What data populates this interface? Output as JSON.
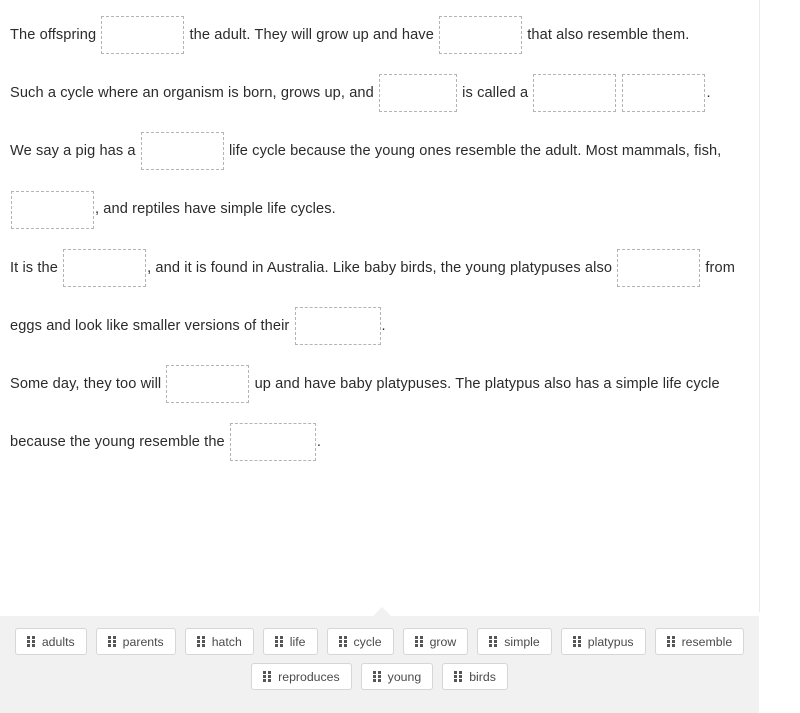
{
  "passage": {
    "paragraphs": [
      {
        "id": "p1",
        "parts": [
          {
            "type": "text",
            "value": "The offspring"
          },
          {
            "type": "blank",
            "name": "blank-1"
          },
          {
            "type": "text",
            "value": "the adult. They will grow up and have"
          },
          {
            "type": "blank",
            "name": "blank-2"
          },
          {
            "type": "text",
            "value": "that also resemble them."
          }
        ]
      },
      {
        "id": "p2",
        "parts": [
          {
            "type": "text",
            "value": "Such a cycle where an organism is born, grows up, and"
          },
          {
            "type": "blank",
            "name": "blank-3"
          },
          {
            "type": "text",
            "value": "is called a"
          },
          {
            "type": "blank",
            "name": "blank-4"
          },
          {
            "type": "blank",
            "name": "blank-5"
          },
          {
            "type": "text",
            "value": "."
          }
        ]
      },
      {
        "id": "p3",
        "parts": [
          {
            "type": "text",
            "value": "We say a pig has a"
          },
          {
            "type": "blank",
            "name": "blank-6"
          },
          {
            "type": "text",
            "value": "life cycle because the young ones resemble the adult. Most mammals, fish,"
          },
          {
            "type": "blank",
            "name": "blank-7"
          },
          {
            "type": "text",
            "value": ", and reptiles have simple life cycles."
          }
        ]
      },
      {
        "id": "p4",
        "parts": [
          {
            "type": "text",
            "value": "It is the"
          },
          {
            "type": "blank",
            "name": "blank-8"
          },
          {
            "type": "text",
            "value": ", and it is found in Australia. Like baby birds, the young platypuses also"
          },
          {
            "type": "blank",
            "name": "blank-9"
          },
          {
            "type": "text",
            "value": "from eggs and look like smaller versions of their"
          },
          {
            "type": "blank",
            "name": "blank-10"
          },
          {
            "type": "text",
            "value": "."
          }
        ]
      },
      {
        "id": "p5",
        "parts": [
          {
            "type": "text",
            "value": "Some day, they too will"
          },
          {
            "type": "blank",
            "name": "blank-11"
          },
          {
            "type": "text",
            "value": "up and have baby platypuses. The platypus also has a simple life cycle because the young resemble the"
          },
          {
            "type": "blank",
            "name": "blank-12"
          },
          {
            "type": "text",
            "value": "."
          }
        ]
      }
    ],
    "texts": {
      "p1_a": "The offspring",
      "p1_b": "the adult. They will grow up and have",
      "p1_c": "that also resemble them.",
      "p2_a": "Such a cycle where an organism is born, grows up, and",
      "p2_b": "is called a",
      "p2_c": ".",
      "p3_a": "We say a pig has a",
      "p3_b": "life cycle because the young ones resemble the adult. Most mammals, fish,",
      "p3_c": ", and reptiles have simple life cycles.",
      "p4_a": "It is the",
      "p4_b": ", and it is found in Australia. Like baby birds, the young platypuses also",
      "p4_c": "from eggs and look like smaller versions of their",
      "p4_d": ".",
      "p5_a": "Some day, they too will",
      "p5_b": "up and have baby platypuses. The platypus also has a simple life cycle because the young resemble the",
      "p5_c": "."
    }
  },
  "word_bank": {
    "icon": "drag-handle-icon",
    "background_color": "#f1f1f1",
    "chip_border_color": "#d6d6d6",
    "chips": [
      {
        "label": "adults"
      },
      {
        "label": "parents"
      },
      {
        "label": "hatch"
      },
      {
        "label": "life"
      },
      {
        "label": "cycle"
      },
      {
        "label": "grow"
      },
      {
        "label": "simple"
      },
      {
        "label": "platypus"
      },
      {
        "label": "resemble"
      },
      {
        "label": "reproduces"
      },
      {
        "label": "young"
      },
      {
        "label": "birds"
      }
    ]
  }
}
